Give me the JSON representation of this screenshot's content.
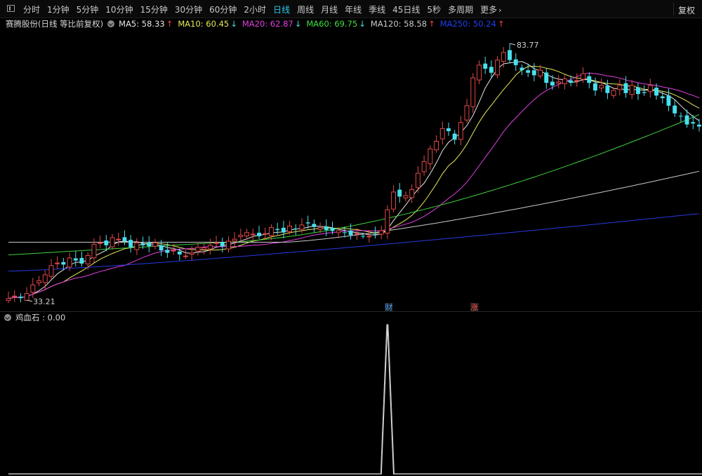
{
  "toolbar": {
    "tabs": [
      {
        "label": "分时",
        "active": false
      },
      {
        "label": "1分钟",
        "active": false
      },
      {
        "label": "5分钟",
        "active": false
      },
      {
        "label": "10分钟",
        "active": false
      },
      {
        "label": "15分钟",
        "active": false
      },
      {
        "label": "30分钟",
        "active": false
      },
      {
        "label": "60分钟",
        "active": false
      },
      {
        "label": "2小时",
        "active": false
      },
      {
        "label": "日线",
        "active": true
      },
      {
        "label": "周线",
        "active": false
      },
      {
        "label": "月线",
        "active": false
      },
      {
        "label": "年线",
        "active": false
      },
      {
        "label": "季线",
        "active": false
      },
      {
        "label": "45日线",
        "active": false
      },
      {
        "label": "5秒",
        "active": false
      },
      {
        "label": "多周期",
        "active": false
      },
      {
        "label": "更多",
        "active": false,
        "chevron": "›"
      }
    ],
    "right_button": "复权"
  },
  "info": {
    "title": "赛腾股份(日线 等比前复权)",
    "ma": [
      {
        "label": "MA5: 58.33",
        "arrow": "↑",
        "color": "#e6e6e6",
        "arrow_color": "#ff4040"
      },
      {
        "label": "MA10: 60.45",
        "arrow": "↓",
        "color": "#e8e85a",
        "arrow_color": "#48e0e0"
      },
      {
        "label": "MA20: 62.87",
        "arrow": "↓",
        "color": "#e040e0",
        "arrow_color": "#48e0e0"
      },
      {
        "label": "MA60: 69.75",
        "arrow": "↓",
        "color": "#40e040",
        "arrow_color": "#48e0e0"
      },
      {
        "label": "MA120: 58.58",
        "arrow": "↑",
        "color": "#c8c8c8",
        "arrow_color": "#ff4040"
      },
      {
        "label": "MA250: 50.24",
        "arrow": "↑",
        "color": "#2040f0",
        "arrow_color": "#ff4040"
      }
    ]
  },
  "chart_data": [
    {
      "type": "candlestick",
      "high_label": "83.77",
      "low_label": "33.21",
      "series": [
        "MA5",
        "MA10",
        "MA20",
        "MA60",
        "MA120",
        "MA250"
      ],
      "colors": {
        "up": "#e04848",
        "down": "#48e0ee",
        "ma5": "#e6e6e6",
        "ma10": "#e8e85a",
        "ma20": "#e040e0",
        "ma60": "#40d040",
        "ma120": "#c8c8c8",
        "ma250": "#2838e0"
      },
      "closes": [
        33.5,
        34.0,
        33.6,
        34.5,
        36.2,
        37.0,
        38.2,
        40.0,
        40.5,
        40.2,
        41.5,
        41.0,
        40.4,
        42.0,
        44.2,
        44.5,
        44.0,
        45.5,
        45.2,
        44.8,
        43.6,
        44.5,
        44.0,
        43.8,
        44.5,
        43.0,
        42.5,
        43.0,
        42.2,
        41.9,
        42.5,
        43.6,
        43.5,
        44.0,
        44.5,
        43.8,
        44.8,
        45.2,
        46.0,
        46.5,
        46.2,
        45.8,
        46.3,
        47.5,
        47.0,
        46.5,
        47.8,
        47.2,
        48.0,
        48.3,
        47.6,
        47.5,
        47.0,
        46.8,
        46.9,
        46.5,
        46.0,
        46.3,
        45.8,
        45.8,
        46.2,
        46.9,
        51.0,
        54.5,
        53.6,
        53.8,
        55.0,
        58.2,
        60.5,
        63.0,
        64.5,
        67.0,
        66.5,
        64.8,
        68.2,
        71.5,
        77.0,
        79.5,
        78.8,
        78.0,
        80.5,
        82.0,
        80.5,
        79.5,
        78.5,
        78.0,
        77.5,
        78.5,
        76.0,
        75.5,
        76.2,
        76.8,
        76.0,
        76.5,
        77.8,
        76.0,
        74.5,
        75.5,
        74.0,
        74.5,
        75.5,
        74.0,
        75.5,
        73.8,
        74.0,
        75.5,
        73.5,
        73.0,
        71.5,
        70.0,
        69.5,
        67.8,
        68.0,
        67.4
      ],
      "ma5_end": 58.33,
      "ma10_end": 60.45,
      "ma20_end": 62.87,
      "ma60_end": 69.75,
      "ma120_end": 58.58,
      "ma250_end": 50.24,
      "markers": [
        {
          "label": "财",
          "color": "#48a0ff"
        },
        {
          "label": "涨",
          "color": "#ff5050"
        }
      ]
    },
    {
      "type": "line",
      "indicator_label": "鸡血石 : 0.00",
      "values": [
        0,
        0,
        0,
        0,
        0,
        0,
        0,
        0,
        0,
        0,
        0,
        0,
        0,
        0,
        0,
        0,
        0,
        0,
        0,
        0,
        0,
        0,
        0,
        0,
        0,
        0,
        0,
        0,
        0,
        0,
        0,
        0,
        0,
        0,
        0,
        0,
        0,
        0,
        0,
        0,
        0,
        0,
        0,
        0,
        0,
        0,
        0,
        0,
        0,
        0,
        0,
        0,
        0,
        0,
        0,
        0,
        0,
        0,
        0,
        0,
        0,
        0,
        1,
        0,
        0,
        0,
        0,
        0,
        0,
        0,
        0,
        0,
        0,
        0,
        0,
        0,
        0,
        0,
        0,
        0,
        0,
        0,
        0,
        0,
        0,
        0,
        0,
        0,
        0,
        0,
        0,
        0,
        0,
        0,
        0,
        0,
        0,
        0,
        0,
        0,
        0,
        0,
        0,
        0,
        0,
        0,
        0,
        0,
        0,
        0,
        0,
        0,
        0,
        0,
        0
      ]
    }
  ]
}
